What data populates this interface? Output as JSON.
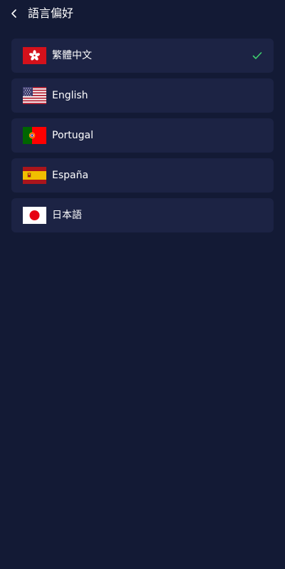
{
  "header": {
    "title": "語言偏好",
    "back_icon": "chevron-left-icon"
  },
  "languages": [
    {
      "label": "繁體中文",
      "flag": "hong-kong-flag-icon",
      "selected": true
    },
    {
      "label": "English",
      "flag": "usa-flag-icon",
      "selected": false
    },
    {
      "label": "Portugal",
      "flag": "portugal-flag-icon",
      "selected": false
    },
    {
      "label": "España",
      "flag": "spain-flag-icon",
      "selected": false
    },
    {
      "label": "日本語",
      "flag": "japan-flag-icon",
      "selected": false
    }
  ],
  "colors": {
    "background": "#131a35",
    "item_background": "#1c2344",
    "check": "#3ecf6e"
  }
}
